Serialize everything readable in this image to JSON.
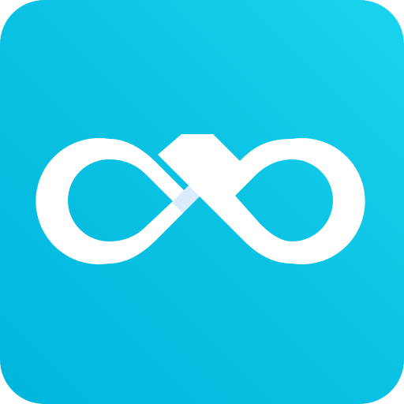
{
  "icon": {
    "name": "infinity-loop-icon",
    "symbol_color": "#ffffff",
    "crossing_shade_color": "#dcebfb",
    "background_color_light": "#1ad4ee",
    "background_color_dark": "#00b6dc"
  }
}
